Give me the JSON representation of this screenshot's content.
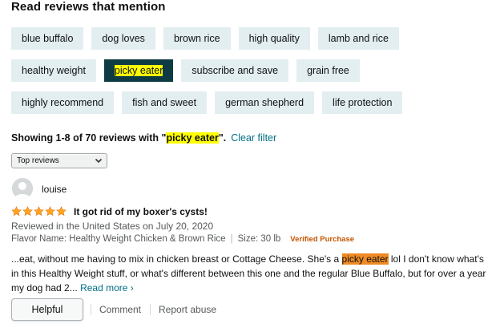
{
  "section_title": "Read reviews that mention",
  "chips": [
    [
      "blue buffalo",
      "dog loves",
      "brown rice",
      "high quality",
      "lamb and rice"
    ],
    [
      "healthy weight",
      "picky eater",
      "subscribe and save",
      "grain free"
    ],
    [
      "highly recommend",
      "fish and sweet",
      "german shepherd",
      "life protection"
    ]
  ],
  "selected_chip": "picky eater",
  "showing": {
    "prefix": "Showing 1-8 of 70 reviews with \"",
    "term": "picky eater",
    "suffix": "\".",
    "clear_filter": "Clear filter"
  },
  "sort": {
    "selected": "Top reviews"
  },
  "review": {
    "author": "louise",
    "rating": 5,
    "title": "It got rid of my boxer's cysts!",
    "date": "Reviewed in the United States on July 20, 2020",
    "flavor": "Flavor Name: Healthy Weight Chicken & Brown Rice",
    "size": "Size: 30 lb",
    "verified": "Verified Purchase",
    "body_before": "...eat, without me having to mix in chicken breast or Cottage Cheese. She's a ",
    "body_highlight": "picky eater",
    "body_after": " lol I don't know what's in this Healthy Weight stuff, or what's different between this one and the regular Blue Buffalo, but for over a year my dog had 2... ",
    "read_more": "Read more ›"
  },
  "actions": {
    "helpful": "Helpful",
    "comment": "Comment",
    "report": "Report abuse"
  },
  "colors": {
    "chip_bg": "#e3eef1",
    "chip_selected_bg": "#0e3b43",
    "highlight_yellow": "#ffff00",
    "highlight_orange": "#f08a24",
    "link": "#007185",
    "star": "#ffa41c",
    "verified": "#c45500"
  }
}
